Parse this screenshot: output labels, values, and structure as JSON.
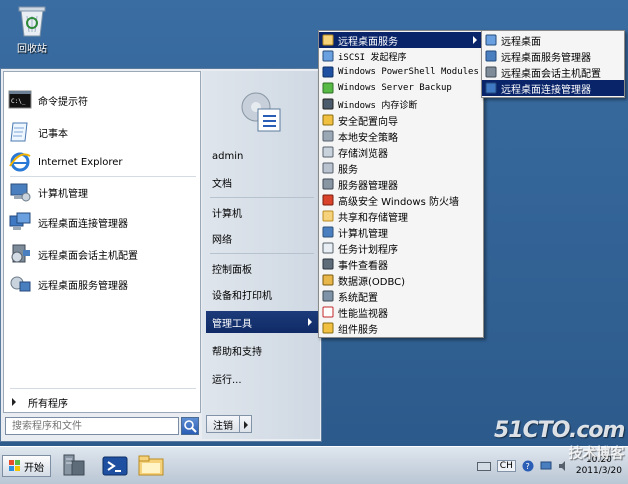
{
  "desktop": {
    "recycle_bin_label": "回收站"
  },
  "start_menu": {
    "pinned": [
      {
        "label": "命令提示符",
        "icon": "cmd-icon"
      },
      {
        "label": "记事本",
        "icon": "notepad-icon"
      },
      {
        "label": "Internet Explorer",
        "icon": "ie-icon"
      },
      {
        "label": "计算机管理",
        "icon": "computer-management-icon"
      },
      {
        "label": "远程桌面连接管理器",
        "icon": "rd-connection-manager-icon"
      },
      {
        "label": "远程桌面会话主机配置",
        "icon": "rd-session-host-config-icon"
      },
      {
        "label": "远程桌面服务管理器",
        "icon": "rd-services-manager-icon"
      }
    ],
    "all_programs": "所有程序",
    "search_placeholder": "搜索程序和文件",
    "right": {
      "user": "admin",
      "items": [
        "文档",
        "计算机",
        "网络",
        "控制面板",
        "设备和打印机",
        "管理工具",
        "帮助和支持",
        "运行..."
      ],
      "highlighted": "管理工具",
      "logoff": "注销"
    }
  },
  "admin_tools_menu": [
    {
      "label": "远程桌面服务",
      "icon": "folder-icon",
      "submenu": true
    },
    {
      "label": "iSCSI 发起程序",
      "icon": "iscsi-icon"
    },
    {
      "label": "Windows PowerShell Modules",
      "icon": "powershell-icon"
    },
    {
      "label": "Windows Server Backup",
      "icon": "backup-icon"
    },
    {
      "label": "Windows 内存诊断",
      "icon": "memory-diagnostic-icon"
    },
    {
      "label": "安全配置向导",
      "icon": "security-wizard-icon"
    },
    {
      "label": "本地安全策略",
      "icon": "local-security-policy-icon"
    },
    {
      "label": "存储浏览器",
      "icon": "storage-explorer-icon"
    },
    {
      "label": "服务",
      "icon": "services-icon"
    },
    {
      "label": "服务器管理器",
      "icon": "server-manager-icon"
    },
    {
      "label": "高级安全 Windows 防火墙",
      "icon": "firewall-icon"
    },
    {
      "label": "共享和存储管理",
      "icon": "share-storage-icon"
    },
    {
      "label": "计算机管理",
      "icon": "computer-management-icon"
    },
    {
      "label": "任务计划程序",
      "icon": "task-scheduler-icon"
    },
    {
      "label": "事件查看器",
      "icon": "event-viewer-icon"
    },
    {
      "label": "数据源(ODBC)",
      "icon": "odbc-icon"
    },
    {
      "label": "系统配置",
      "icon": "system-config-icon"
    },
    {
      "label": "性能监视器",
      "icon": "performance-monitor-icon"
    },
    {
      "label": "组件服务",
      "icon": "component-services-icon"
    }
  ],
  "rds_menu": [
    {
      "label": "远程桌面",
      "icon": "remote-desktop-icon"
    },
    {
      "label": "远程桌面服务管理器",
      "icon": "rd-services-manager-icon"
    },
    {
      "label": "远程桌面会话主机配置",
      "icon": "rd-session-host-config-icon"
    },
    {
      "label": "远程桌面连接管理器",
      "icon": "rd-connection-manager-icon",
      "highlighted": true
    }
  ],
  "taskbar": {
    "start_label": "开始",
    "lang": "CH",
    "clock_time": "10:20",
    "clock_date": "2011/3/20"
  },
  "watermark": {
    "main": "51CTO.com",
    "sub": "技术博客"
  },
  "colors": {
    "highlight": "#0a246a",
    "desktop": "#2d5a8e",
    "menu_bg": "#f5f5f5"
  }
}
